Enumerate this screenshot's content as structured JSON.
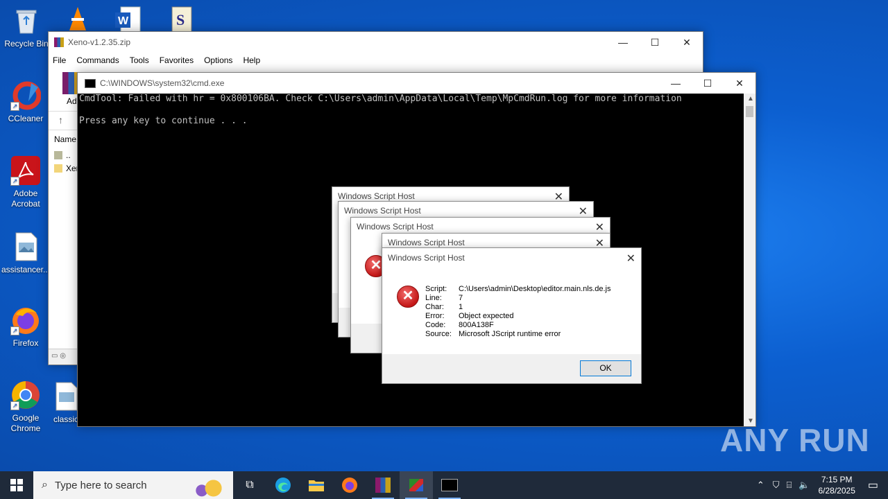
{
  "desktop": {
    "icons": [
      {
        "label": "Recycle Bin"
      },
      {
        "label": "CCleaner"
      },
      {
        "label": "Adobe Acrobat"
      },
      {
        "label": "assistancer..."
      },
      {
        "label": "Firefox"
      },
      {
        "label": "Google Chrome"
      },
      {
        "label": "classic"
      }
    ],
    "watermark": "ANY RUN"
  },
  "winrar": {
    "title": "Xeno-v1.2.35.zip",
    "menu": [
      "File",
      "Commands",
      "Tools",
      "Favorites",
      "Options",
      "Help"
    ],
    "toolbar_partial": "Ad",
    "column_name": "Name",
    "rows": [
      "..",
      "Xen"
    ]
  },
  "cmd": {
    "title": "C:\\WINDOWS\\system32\\cmd.exe",
    "lines": [
      "CmdTool: Failed with hr = 0x800106BA. Check C:\\Users\\admin\\AppData\\Local\\Temp\\MpCmdRun.log for more information",
      "",
      "Press any key to continue . . ."
    ]
  },
  "wsh": {
    "title": "Windows Script Host",
    "fields": [
      {
        "label": "Script:",
        "value": "C:\\Users\\admin\\Desktop\\editor.main.nls.de.js"
      },
      {
        "label": "Line:",
        "value": "7"
      },
      {
        "label": "Char:",
        "value": "1"
      },
      {
        "label": "Error:",
        "value": "Object expected"
      },
      {
        "label": "Code:",
        "value": "800A138F"
      },
      {
        "label": "Source:",
        "value": "Microsoft JScript runtime error"
      }
    ],
    "ok_label": "OK"
  },
  "taskbar": {
    "search_placeholder": "Type here to search",
    "time": "7:15 PM",
    "date": "6/28/2025"
  }
}
